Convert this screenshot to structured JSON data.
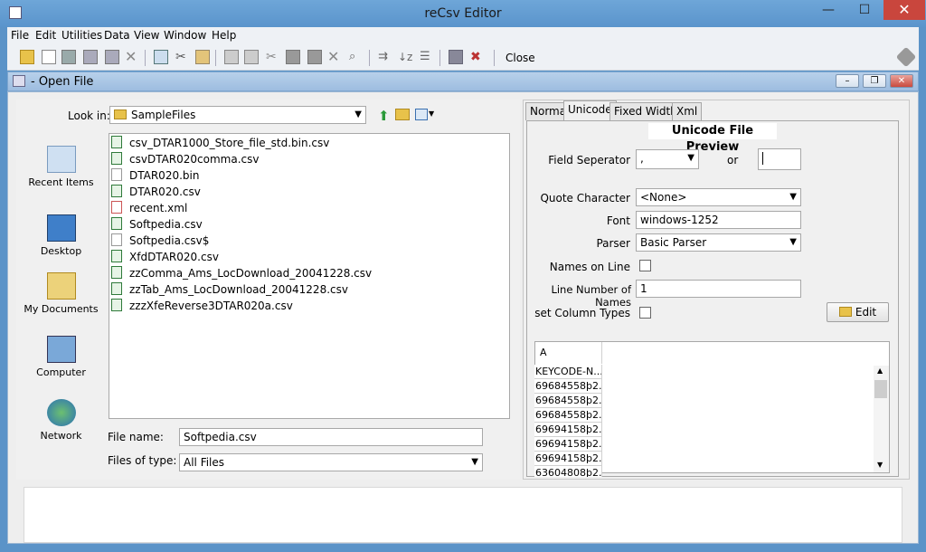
{
  "window": {
    "title": "reCsv Editor",
    "close_glyph": "✕",
    "min_glyph": "—",
    "max_glyph": "☐"
  },
  "menubar": [
    "File",
    "Edit",
    "Utilities",
    "Data",
    "View",
    "Window",
    "Help"
  ],
  "toolbar": {
    "close_label": "Close"
  },
  "internal_frame": {
    "title": "- Open File"
  },
  "open_file": {
    "look_in_label": "Look in:",
    "look_in_value": "SampleFiles",
    "places": [
      {
        "label": "Recent Items",
        "icon": "recent-items-icon"
      },
      {
        "label": "Desktop",
        "icon": "desktop-icon"
      },
      {
        "label": "My Documents",
        "icon": "documents-folder-icon"
      },
      {
        "label": "Computer",
        "icon": "computer-icon"
      },
      {
        "label": "Network",
        "icon": "network-icon"
      }
    ],
    "files": [
      {
        "name": "csv_DTAR1000_Store_file_std.bin.csv",
        "icon": "csv"
      },
      {
        "name": "csvDTAR020comma.csv",
        "icon": "csv"
      },
      {
        "name": "DTAR020.bin",
        "icon": "plain"
      },
      {
        "name": "DTAR020.csv",
        "icon": "csv"
      },
      {
        "name": "recent.xml",
        "icon": "xml"
      },
      {
        "name": "Softpedia.csv",
        "icon": "csv"
      },
      {
        "name": "Softpedia.csv$",
        "icon": "plain"
      },
      {
        "name": "XfdDTAR020.csv",
        "icon": "csv"
      },
      {
        "name": "zzComma_Ams_LocDownload_20041228.csv",
        "icon": "csv"
      },
      {
        "name": "zzTab_Ams_LocDownload_20041228.csv",
        "icon": "csv"
      },
      {
        "name": "zzzXfeReverse3DTAR020a.csv",
        "icon": "csv"
      }
    ],
    "file_name_label": "File name:",
    "file_name_value": "Softpedia.csv",
    "files_of_type_label": "Files of type:",
    "files_of_type_value": "All Files"
  },
  "tabs": [
    "Normal",
    "Unicode",
    "Fixed Width",
    "Xml"
  ],
  "active_tab": "Unicode",
  "unicode_panel": {
    "title": "Unicode File Preview",
    "field_separator_label": "Field Seperator",
    "field_separator_value": ",",
    "or_label": "or",
    "quote_char_label": "Quote Character",
    "quote_char_value": "<None>",
    "font_label": "Font",
    "font_value": "windows-1252",
    "parser_label": "Parser",
    "parser_value": "Basic Parser",
    "names_on_line_label": "Names on Line",
    "line_number_label": "Line Number of Names",
    "line_number_value": "1",
    "set_column_types_label": "set Column Types",
    "edit_button": "Edit"
  },
  "preview_grid": {
    "column_header": "A",
    "rows": [
      "KEYCODE-N...",
      "69684558þ2...",
      "69684558þ2...",
      "69684558þ2...",
      "69694158þ2...",
      "69694158þ2...",
      "69694158þ2...",
      "63604808þ2..."
    ]
  }
}
